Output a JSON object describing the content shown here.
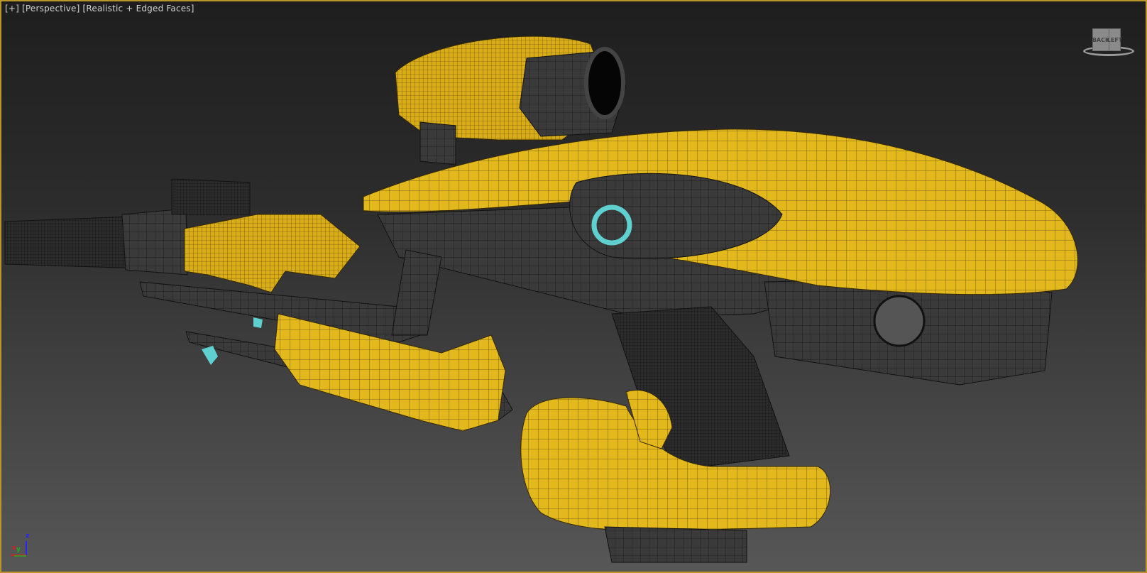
{
  "viewport": {
    "label_plus": "[+]",
    "label_view": "[Perspective]",
    "label_shading": "[Realistic + Edged Faces]"
  },
  "viewcube": {
    "face_back": "BACK",
    "face_left": "LEFT"
  },
  "axis_gizmo": {
    "x": "x",
    "y": "y",
    "z": "z"
  },
  "colors": {
    "border": "#b8962a",
    "model_yellow": "#e3b81c",
    "model_dark": "#3a3a3a",
    "accent_cyan": "#5fd0d0"
  }
}
